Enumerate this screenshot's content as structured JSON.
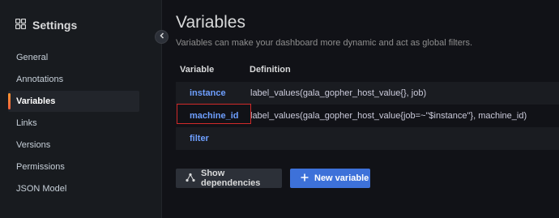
{
  "sidebar": {
    "title": "Settings",
    "items": [
      {
        "label": "General"
      },
      {
        "label": "Annotations"
      },
      {
        "label": "Variables"
      },
      {
        "label": "Links"
      },
      {
        "label": "Versions"
      },
      {
        "label": "Permissions"
      },
      {
        "label": "JSON Model"
      }
    ],
    "active_item": "Variables"
  },
  "main": {
    "title": "Variables",
    "subtitle": "Variables can make your dashboard more dynamic and act as global filters.",
    "table": {
      "headers": [
        "Variable",
        "Definition"
      ],
      "rows": [
        {
          "name": "instance",
          "definition": "label_values(gala_gopher_host_value{}, job)"
        },
        {
          "name": "machine_id",
          "definition": "label_values(gala_gopher_host_value{job=~\"$instance\"}, machine_id)"
        },
        {
          "name": "filter",
          "definition": ""
        }
      ]
    },
    "buttons": {
      "show_dependencies": "Show dependencies",
      "new_variable": "New variable"
    }
  },
  "colors": {
    "link": "#6e9fff",
    "primary_button": "#3d71d9",
    "active_indicator": "#ff9830",
    "highlight": "#d12a2a"
  }
}
